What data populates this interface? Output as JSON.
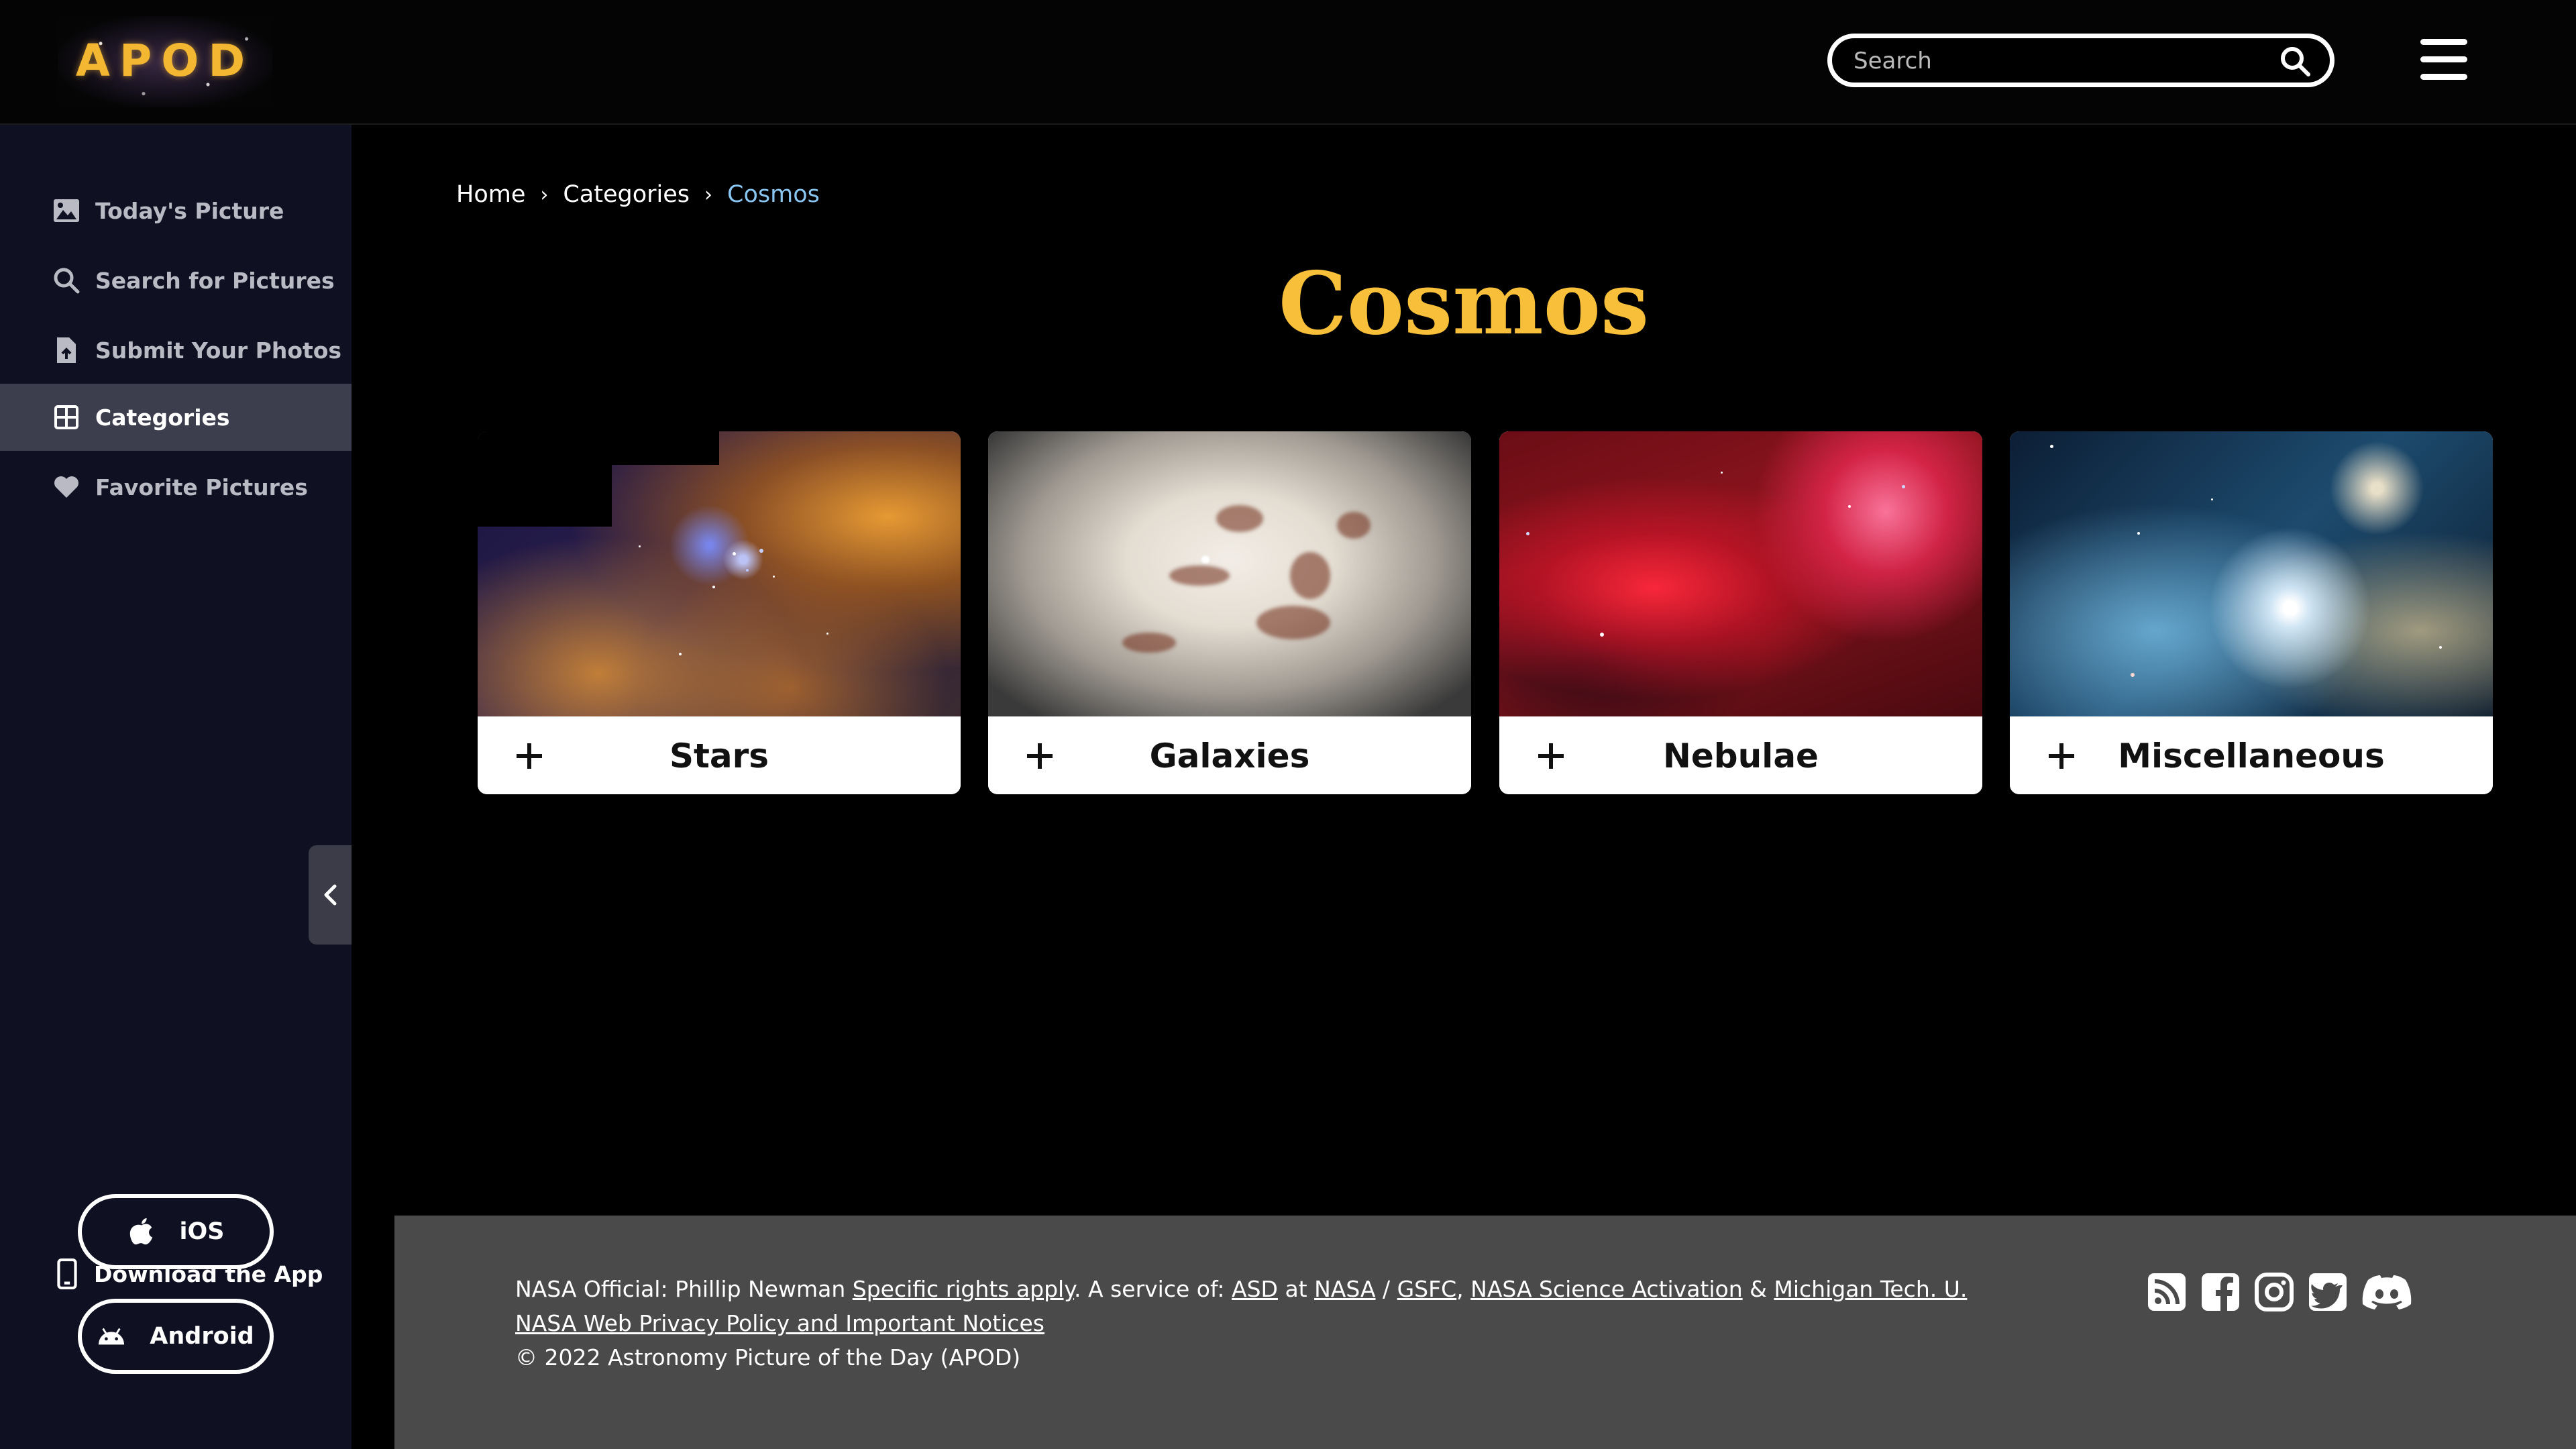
{
  "header": {
    "logo_text": "APOD",
    "search_placeholder": "Search"
  },
  "sidebar": {
    "items": [
      {
        "label": "Today's Picture",
        "icon": "image-icon"
      },
      {
        "label": "Search for Pictures",
        "icon": "search-icon"
      },
      {
        "label": "Submit Your Photos",
        "icon": "file-upload-icon"
      },
      {
        "label": "Categories",
        "icon": "grid-icon",
        "active": true
      },
      {
        "label": "Favorite Pictures",
        "icon": "heart-icon"
      }
    ],
    "download_label": "Download the App",
    "ios_label": "iOS",
    "android_label": "Android"
  },
  "breadcrumb": {
    "home": "Home",
    "categories": "Categories",
    "current": "Cosmos"
  },
  "page_title": "Cosmos",
  "cards": [
    {
      "label": "Stars"
    },
    {
      "label": "Galaxies"
    },
    {
      "label": "Nebulae"
    },
    {
      "label": "Miscellaneous"
    }
  ],
  "footer": {
    "official_prefix": "NASA Official: Phillip Newman ",
    "rights_link": "Specific rights apply",
    "service_text": ". A service of: ",
    "asd_link": "ASD",
    "at_text": " at ",
    "nasa_link": "NASA",
    "slash_text": " / ",
    "gsfc_link": "GSFC",
    "comma_text": ", ",
    "activation_link": "NASA Science Activation",
    "amp_text": " & ",
    "mtu_link": "Michigan Tech. U.",
    "privacy_link": "NASA Web Privacy Policy and Important Notices",
    "copyright": "© 2022 Astronomy Picture of the Day (APOD)"
  },
  "colors": {
    "accent_gold": "#f7bf3a",
    "sidebar_bg": "#0f1021",
    "active_bg": "#3d3e4d",
    "breadcrumb_current": "#8ac6f2",
    "footer_bg": "#4a4a4a"
  }
}
